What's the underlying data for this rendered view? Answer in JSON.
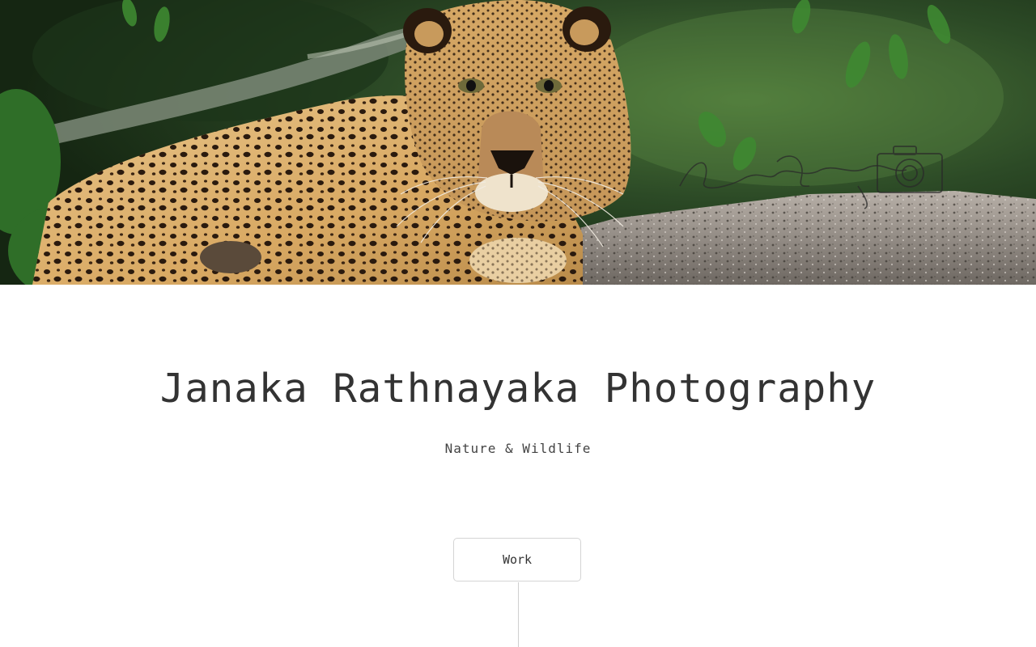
{
  "hero": {
    "alt": "Leopard resting on a rock",
    "watermark_icon": "camera-icon"
  },
  "header": {
    "title": "Janaka Rathnayaka Photography",
    "tagline": "Nature & Wildlife"
  },
  "nav": {
    "work_label": "Work"
  },
  "colors": {
    "text": "#333333",
    "border": "#d4d4d4",
    "background": "#ffffff"
  }
}
